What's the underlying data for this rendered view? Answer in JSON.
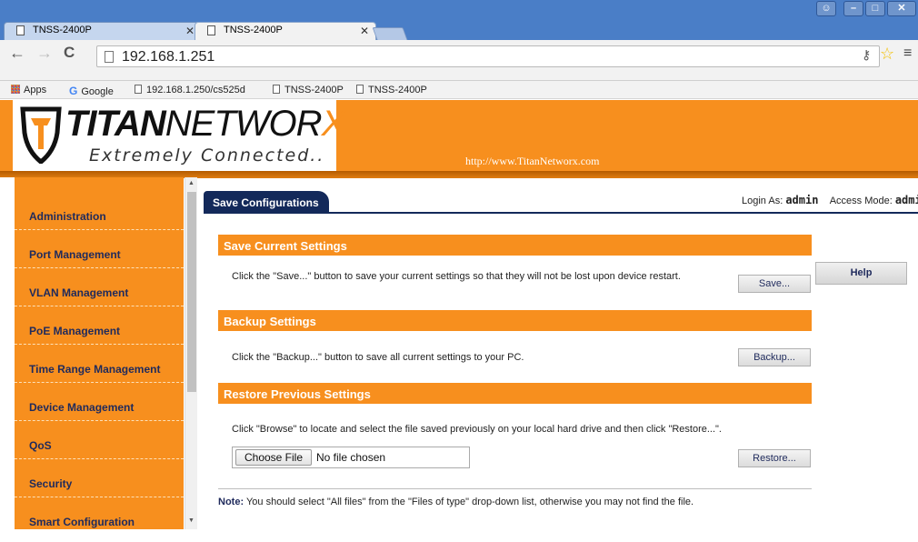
{
  "browser": {
    "tabs": [
      {
        "label": "TNSS-2400P",
        "active": false
      },
      {
        "label": "TNSS-2400P",
        "active": true
      }
    ],
    "address": "192.168.1.251",
    "bookmarks": [
      {
        "label": "Apps",
        "icon": "apps-icon"
      },
      {
        "label": "Google",
        "icon": "google-icon"
      },
      {
        "label": "192.168.1.250/cs525d",
        "icon": "page-icon"
      },
      {
        "label": "TNSS-2400P",
        "icon": "page-icon"
      },
      {
        "label": "TNSS-2400P",
        "icon": "page-icon"
      }
    ]
  },
  "header": {
    "brand_bold": "TITAN",
    "brand_light": "NETWOR",
    "brand_x": "X",
    "tagline": "Extremely Connected..",
    "site_url": "http://www.TitanNetworx.com",
    "accent_color": "#f78f1e",
    "navy_color": "#13295a"
  },
  "sidebar": {
    "items": [
      {
        "label": "Administration"
      },
      {
        "label": "Port Management"
      },
      {
        "label": "VLAN Management"
      },
      {
        "label": "PoE Management"
      },
      {
        "label": "Time Range Management"
      },
      {
        "label": "Device Management"
      },
      {
        "label": "QoS"
      },
      {
        "label": "Security"
      },
      {
        "label": "Smart Configuration"
      }
    ]
  },
  "main": {
    "tab_label": "Save Configurations",
    "login_label": "Login As: ",
    "login_user": "admin",
    "access_label": "Access Mode: ",
    "access_mode": "admi",
    "help_label": "Help",
    "sections": {
      "save": {
        "title": "Save Current Settings",
        "description": "Click the \"Save...\" button to save your current settings so that they will not be lost upon device restart.",
        "button": "Save..."
      },
      "backup": {
        "title": "Backup Settings",
        "description": "Click the \"Backup...\" button to save all current settings to your PC.",
        "button": "Backup..."
      },
      "restore": {
        "title": "Restore Previous Settings",
        "description": "Click \"Browse\" to locate and select the file saved previously on your local hard drive and then click \"Restore...\".",
        "choose_file": "Choose File",
        "file_status": "No file chosen",
        "button": "Restore..."
      }
    },
    "note_label": "Note:",
    "note_text": " You should select \"All files\" from the \"Files of type\" drop-down list, otherwise you may not find the file."
  }
}
